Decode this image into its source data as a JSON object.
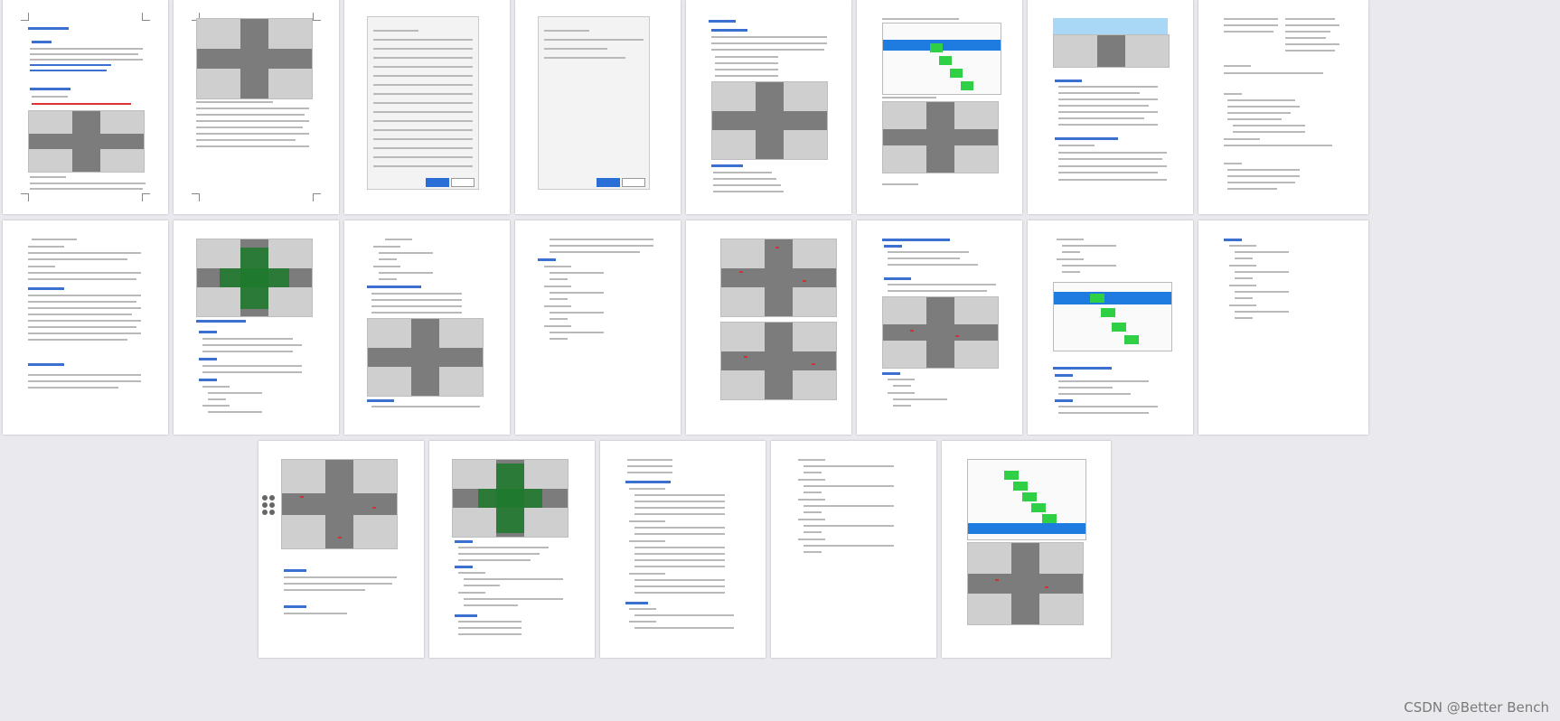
{
  "watermark": "CSDN @Better Bench",
  "thumbnail_grid": {
    "rows": 3,
    "pages_per_row": [
      8,
      8,
      5
    ]
  }
}
